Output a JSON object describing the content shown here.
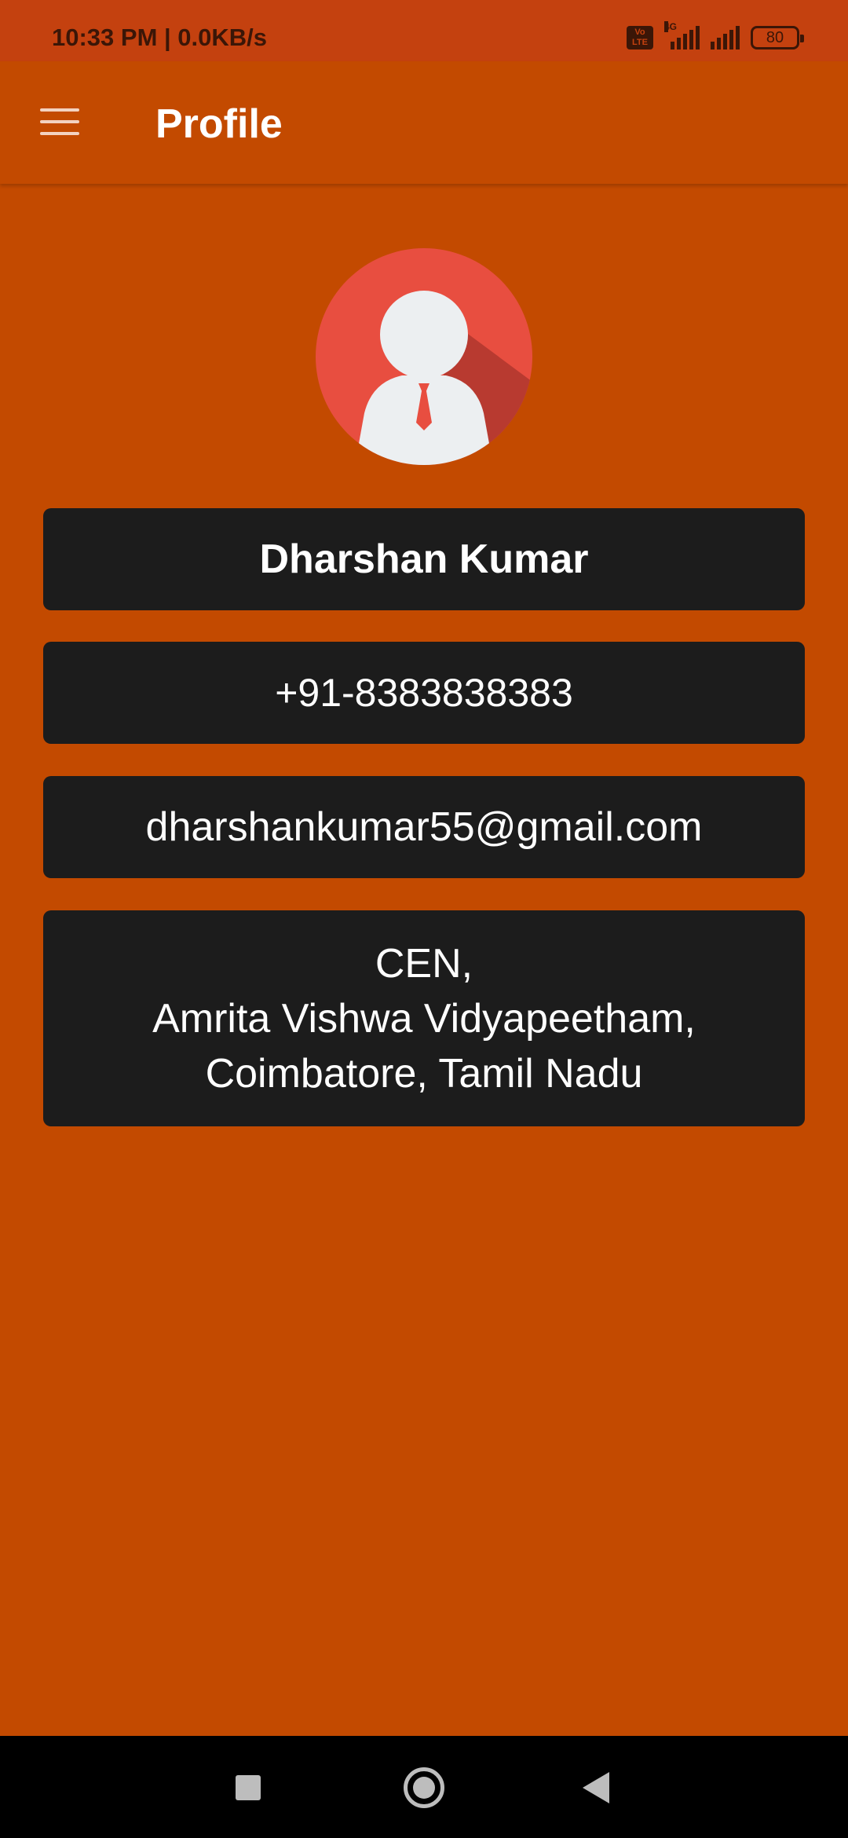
{
  "status_bar": {
    "time": "10:33 PM | 0.0KB/s",
    "volte_label": "Vo\nLTE",
    "network_label": "4G",
    "battery": "80"
  },
  "app_bar": {
    "title": "Profile",
    "menu_icon": "hamburger-menu-icon"
  },
  "profile": {
    "avatar_icon": "user-avatar-icon",
    "name": "Dharshan Kumar",
    "phone": "+91-8383838383",
    "email": "dharshankumar55@gmail.com",
    "address_lines": [
      "CEN,",
      "Amrita Vishwa Vidyapeetham,",
      "Coimbatore, Tamil Nadu"
    ]
  },
  "colors": {
    "background": "#C34A00",
    "status_bar": "#C4410F",
    "card": "#1C1C1C",
    "avatar_circle": "#E84E40"
  },
  "nav_bar": {
    "recents_icon": "square-recents-icon",
    "home_icon": "circle-home-icon",
    "back_icon": "triangle-back-icon"
  }
}
